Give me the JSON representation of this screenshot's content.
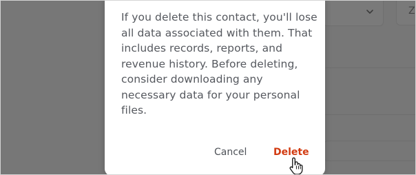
{
  "background": {
    "select_chevron_icon": "chevron-down-icon",
    "z_button_label": "Z"
  },
  "dialog": {
    "message": "If you delete this contact, you'll lose all data associated with them. That includes records, reports, and revenue history. Before deleting, consider downloading any necessary data for your personal files.",
    "cancel_label": "Cancel",
    "delete_label": "Delete"
  },
  "colors": {
    "overlay": "#777777",
    "dialog_bg": "#ffffff",
    "body_text": "#55585e",
    "cancel_text": "#4d5157",
    "delete_text": "#d23a10"
  },
  "cursor": {
    "icon": "hand-pointer-icon"
  }
}
